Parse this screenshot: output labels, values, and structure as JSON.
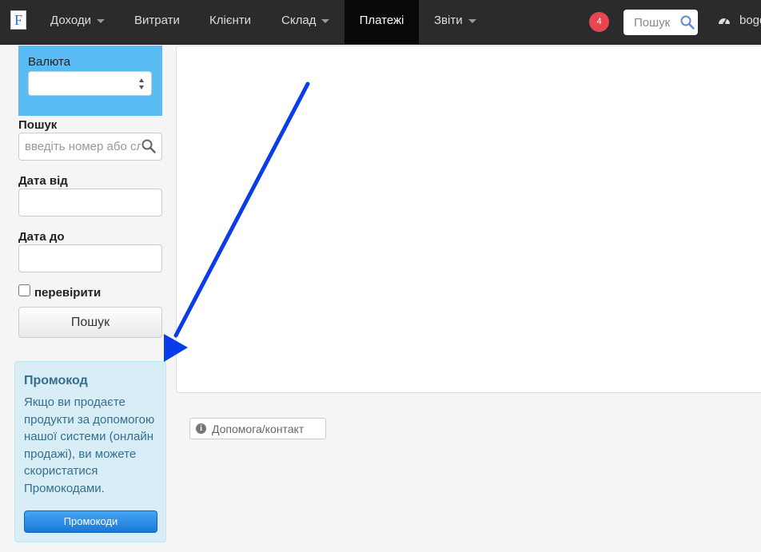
{
  "navbar": {
    "logo_letter": "F",
    "items": [
      {
        "label": "Доходи",
        "dropdown": true
      },
      {
        "label": "Витрати",
        "dropdown": false
      },
      {
        "label": "Клієнти",
        "dropdown": false
      },
      {
        "label": "Склад",
        "dropdown": true
      },
      {
        "label": "Платежі",
        "dropdown": false,
        "active": true
      },
      {
        "label": "Звіти",
        "dropdown": true
      }
    ],
    "notification_count": "4",
    "search_placeholder": "Пошук",
    "user_name": "bogd"
  },
  "filter": {
    "currency_label": "Валюта",
    "currency_value": "",
    "search_label": "Пошук",
    "search_placeholder": "введіть номер або сл",
    "date_from_label": "Дата від",
    "date_from_value": "",
    "date_to_label": "Дата до",
    "date_to_value": "",
    "check_label": "перевірити",
    "check_checked": false,
    "search_button": "Пошук"
  },
  "promo": {
    "title": "Промокод",
    "text": "Якщо ви продаєте продукти за допомогою нашої системи (онлайн продажі), ви можете скористатися Промокодами.",
    "button": "Промокоди"
  },
  "help": {
    "label": "Допомога/контакт"
  },
  "colors": {
    "navbar_bg": "#2b2b2b",
    "active_tab_bg": "#080808",
    "badge": "#e8474f",
    "currency_panel": "#5bbcf5",
    "promo_bg": "#d9edf7",
    "promo_text": "#31708f",
    "annotation_arrow": "#0a3de8"
  }
}
